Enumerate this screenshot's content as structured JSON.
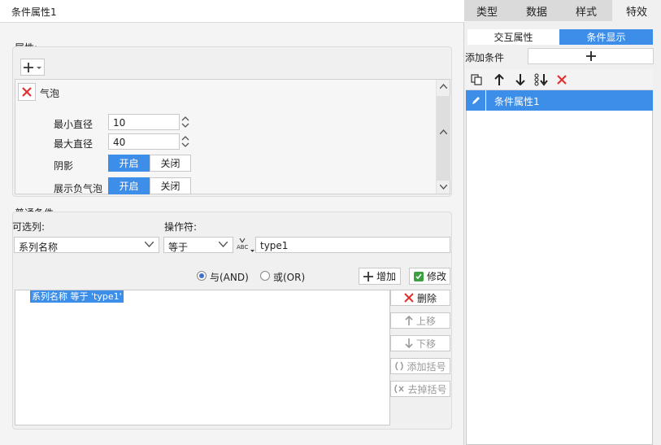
{
  "title": "条件属性1",
  "attributes": {
    "label": "属性:",
    "bubble_label": "气泡",
    "min_diameter": {
      "label": "最小直径",
      "value": "10"
    },
    "max_diameter": {
      "label": "最大直径",
      "value": "40"
    },
    "shadow": {
      "label": "阴影",
      "on": "开启",
      "off": "关闭"
    },
    "show_negative": {
      "label": "展示负气泡",
      "on": "开启",
      "off": "关闭"
    }
  },
  "conditions": {
    "label": "普通条件",
    "selectable_col_label": "可选列:",
    "selectable_col_value": "系列名称",
    "operator_label": "操作符:",
    "operator_value": "等于",
    "value_input": "type1",
    "and_label": "与(AND)",
    "or_label": "或(OR)",
    "add_label": "增加",
    "modify_label": "修改",
    "list_item": "系列名称 等于 'type1'",
    "delete_label": "删除",
    "move_up_label": "上移",
    "move_down_label": "下移",
    "add_bracket_label": "添加括号",
    "remove_bracket_label": "去掉括号",
    "abc_label": "ABC"
  },
  "right": {
    "tabs": [
      "类型",
      "数据",
      "样式",
      "特效"
    ],
    "sub_tabs": [
      "交互属性",
      "条件显示"
    ],
    "add_condition_label": "添加条件",
    "list_item": "条件属性1"
  },
  "colors": {
    "accent": "#3d8ee8",
    "selected": "#3d8ee8",
    "delete": "#e03030"
  }
}
